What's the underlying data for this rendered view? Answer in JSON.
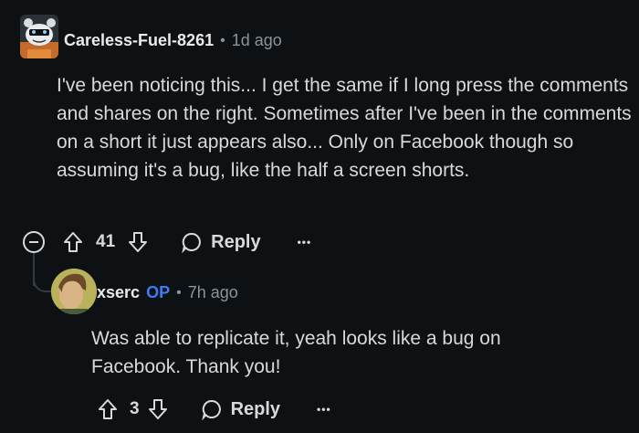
{
  "comment": {
    "username": "Careless-Fuel-8261",
    "time": "1d ago",
    "separator": "•",
    "body": "I've been noticing this... I get the same if I long press the comments and shares on the right. Sometimes after I've been in the comments on a short it just appears also... Only on Facebook though so assuming it's a bug, like the half a screen shorts.",
    "votes": "41",
    "reply_label": "Reply",
    "more_label": "•••",
    "icons": {
      "avatar": "snoo-avatar",
      "collapse": "collapse-minus-icon",
      "upvote": "arrow-up-icon",
      "downvote": "arrow-down-icon",
      "reply": "speech-bubble-icon",
      "more": "ellipsis-icon"
    }
  },
  "reply": {
    "username": "xserc",
    "badge": "OP",
    "separator": "•",
    "time": "7h ago",
    "body": "Was able to replicate it, yeah looks like a bug on Facebook. Thank you!",
    "votes": "3",
    "reply_label": "Reply",
    "more_label": "•••"
  },
  "colors": {
    "background": "#0e1113",
    "text": "#d7dadc",
    "muted": "#8b949e",
    "op_badge": "#3d7bf7"
  }
}
